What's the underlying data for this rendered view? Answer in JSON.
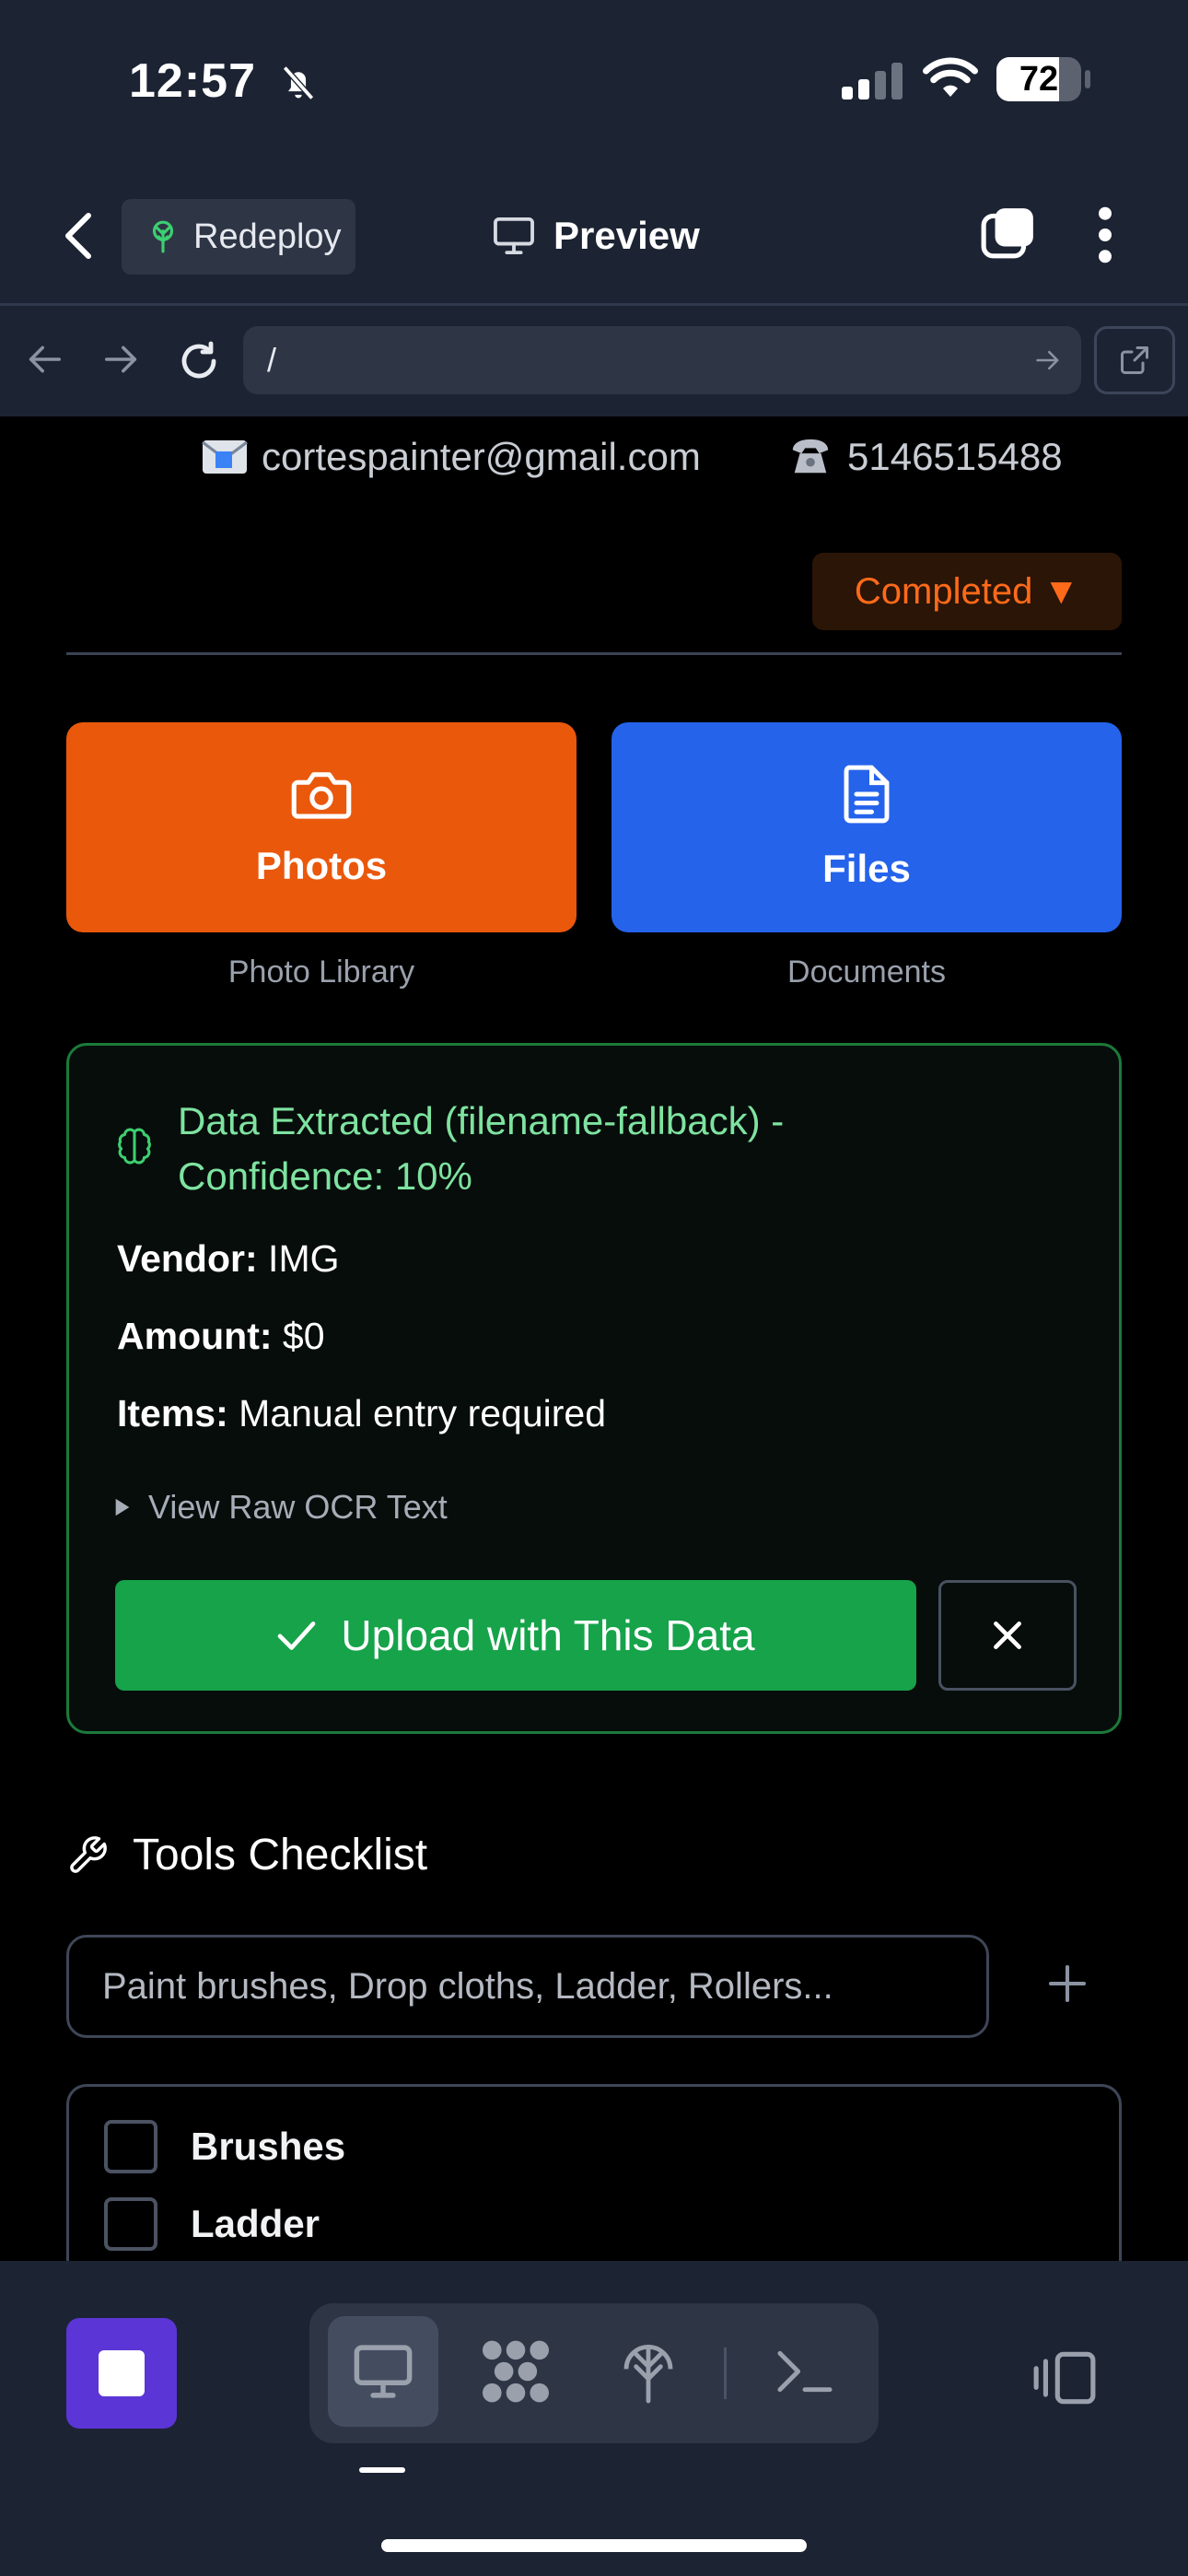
{
  "status_bar": {
    "time": "12:57",
    "battery": "72"
  },
  "header": {
    "back_label": "Back",
    "redeploy_label": "Redeploy",
    "preview_label": "Preview"
  },
  "url_bar": {
    "url": "/"
  },
  "contact": {
    "email": "cortespainter@gmail.com",
    "phone": "5146515488"
  },
  "job_status": {
    "label": "Completed ▼",
    "color": "#ff6a1a"
  },
  "upload_buttons": [
    {
      "label": "Photos",
      "caption": "Photo Library",
      "icon": "camera-icon",
      "color": "#ea580c"
    },
    {
      "label": "Files",
      "caption": "Documents",
      "icon": "file-icon",
      "color": "#2563eb"
    }
  ],
  "ocr_panel": {
    "title": "Data Extracted (filename-fallback) - Confidence: 10%",
    "fields": [
      {
        "label": "Vendor:",
        "value": "IMG"
      },
      {
        "label": "Amount:",
        "value": "$0"
      },
      {
        "label": "Items:",
        "value": "Manual entry required"
      }
    ],
    "raw_toggle": "View Raw OCR Text",
    "upload_label": "Upload with This Data"
  },
  "tools_checklist": {
    "title": "Tools Checklist",
    "placeholder": "Paint brushes, Drop cloths, Ladder, Rollers...",
    "items": [
      "Brushes",
      "Ladder"
    ]
  }
}
